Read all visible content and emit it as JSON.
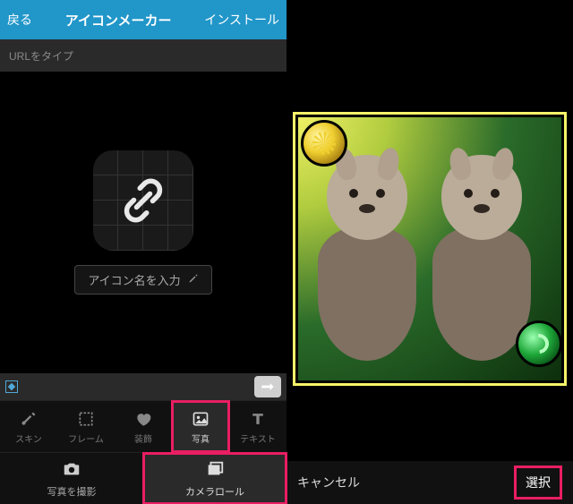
{
  "header": {
    "back": "戻る",
    "title": "アイコンメーカー",
    "install": "インストール"
  },
  "url_placeholder": "URLをタイプ",
  "icon_name_placeholder": "アイコン名を入力",
  "tabs": {
    "skin": "スキン",
    "frame": "フレーム",
    "decor": "装飾",
    "photo": "写真",
    "text": "テキスト"
  },
  "photo_actions": {
    "shoot": "写真を撮影",
    "roll": "カメラロール"
  },
  "right": {
    "cancel": "キャンセル",
    "select": "選択"
  }
}
